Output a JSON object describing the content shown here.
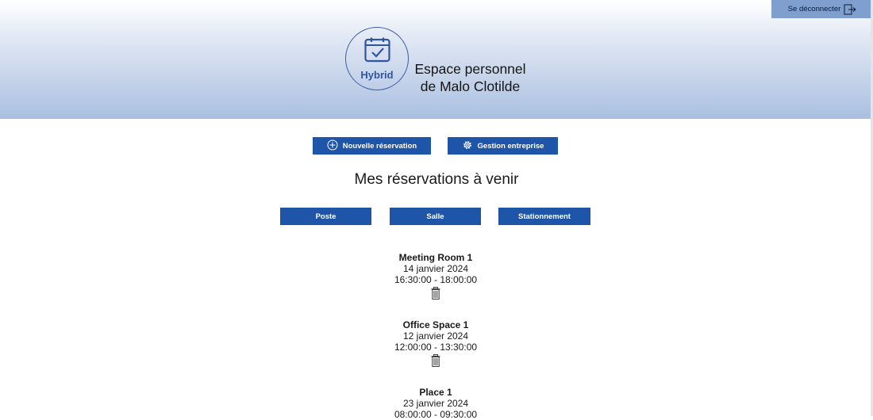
{
  "header": {
    "logout_label": "Se déconnecter",
    "logo_text": "Hybrid",
    "title_line1": "Espace personnel",
    "title_line2": "de Malo Clotilde"
  },
  "actions": {
    "new_reservation": "Nouvelle réservation",
    "company_management": "Gestion entreprise"
  },
  "section": {
    "title": "Mes réservations à venir"
  },
  "filters": {
    "desk": "Poste",
    "room": "Salle",
    "parking": "Stationnement"
  },
  "reservations": [
    {
      "name": "Meeting Room 1",
      "date": "14 janvier 2024",
      "time": "16:30:00 - 18:00:00"
    },
    {
      "name": "Office Space 1",
      "date": "12 janvier 2024",
      "time": "12:00:00 - 13:30:00"
    },
    {
      "name": "Place 1",
      "date": "23 janvier 2024",
      "time": "08:00:00 - 09:30:00"
    }
  ],
  "icons": {
    "logout": "logout-icon",
    "logo": "calendar-check-icon",
    "new_reservation": "plus-circle-icon",
    "company_management": "gear-icon",
    "delete": "trash-icon"
  },
  "colors": {
    "primary_button": "#1f55a8",
    "logout_background": "#7f9fcf",
    "brand": "#2f55a0"
  }
}
